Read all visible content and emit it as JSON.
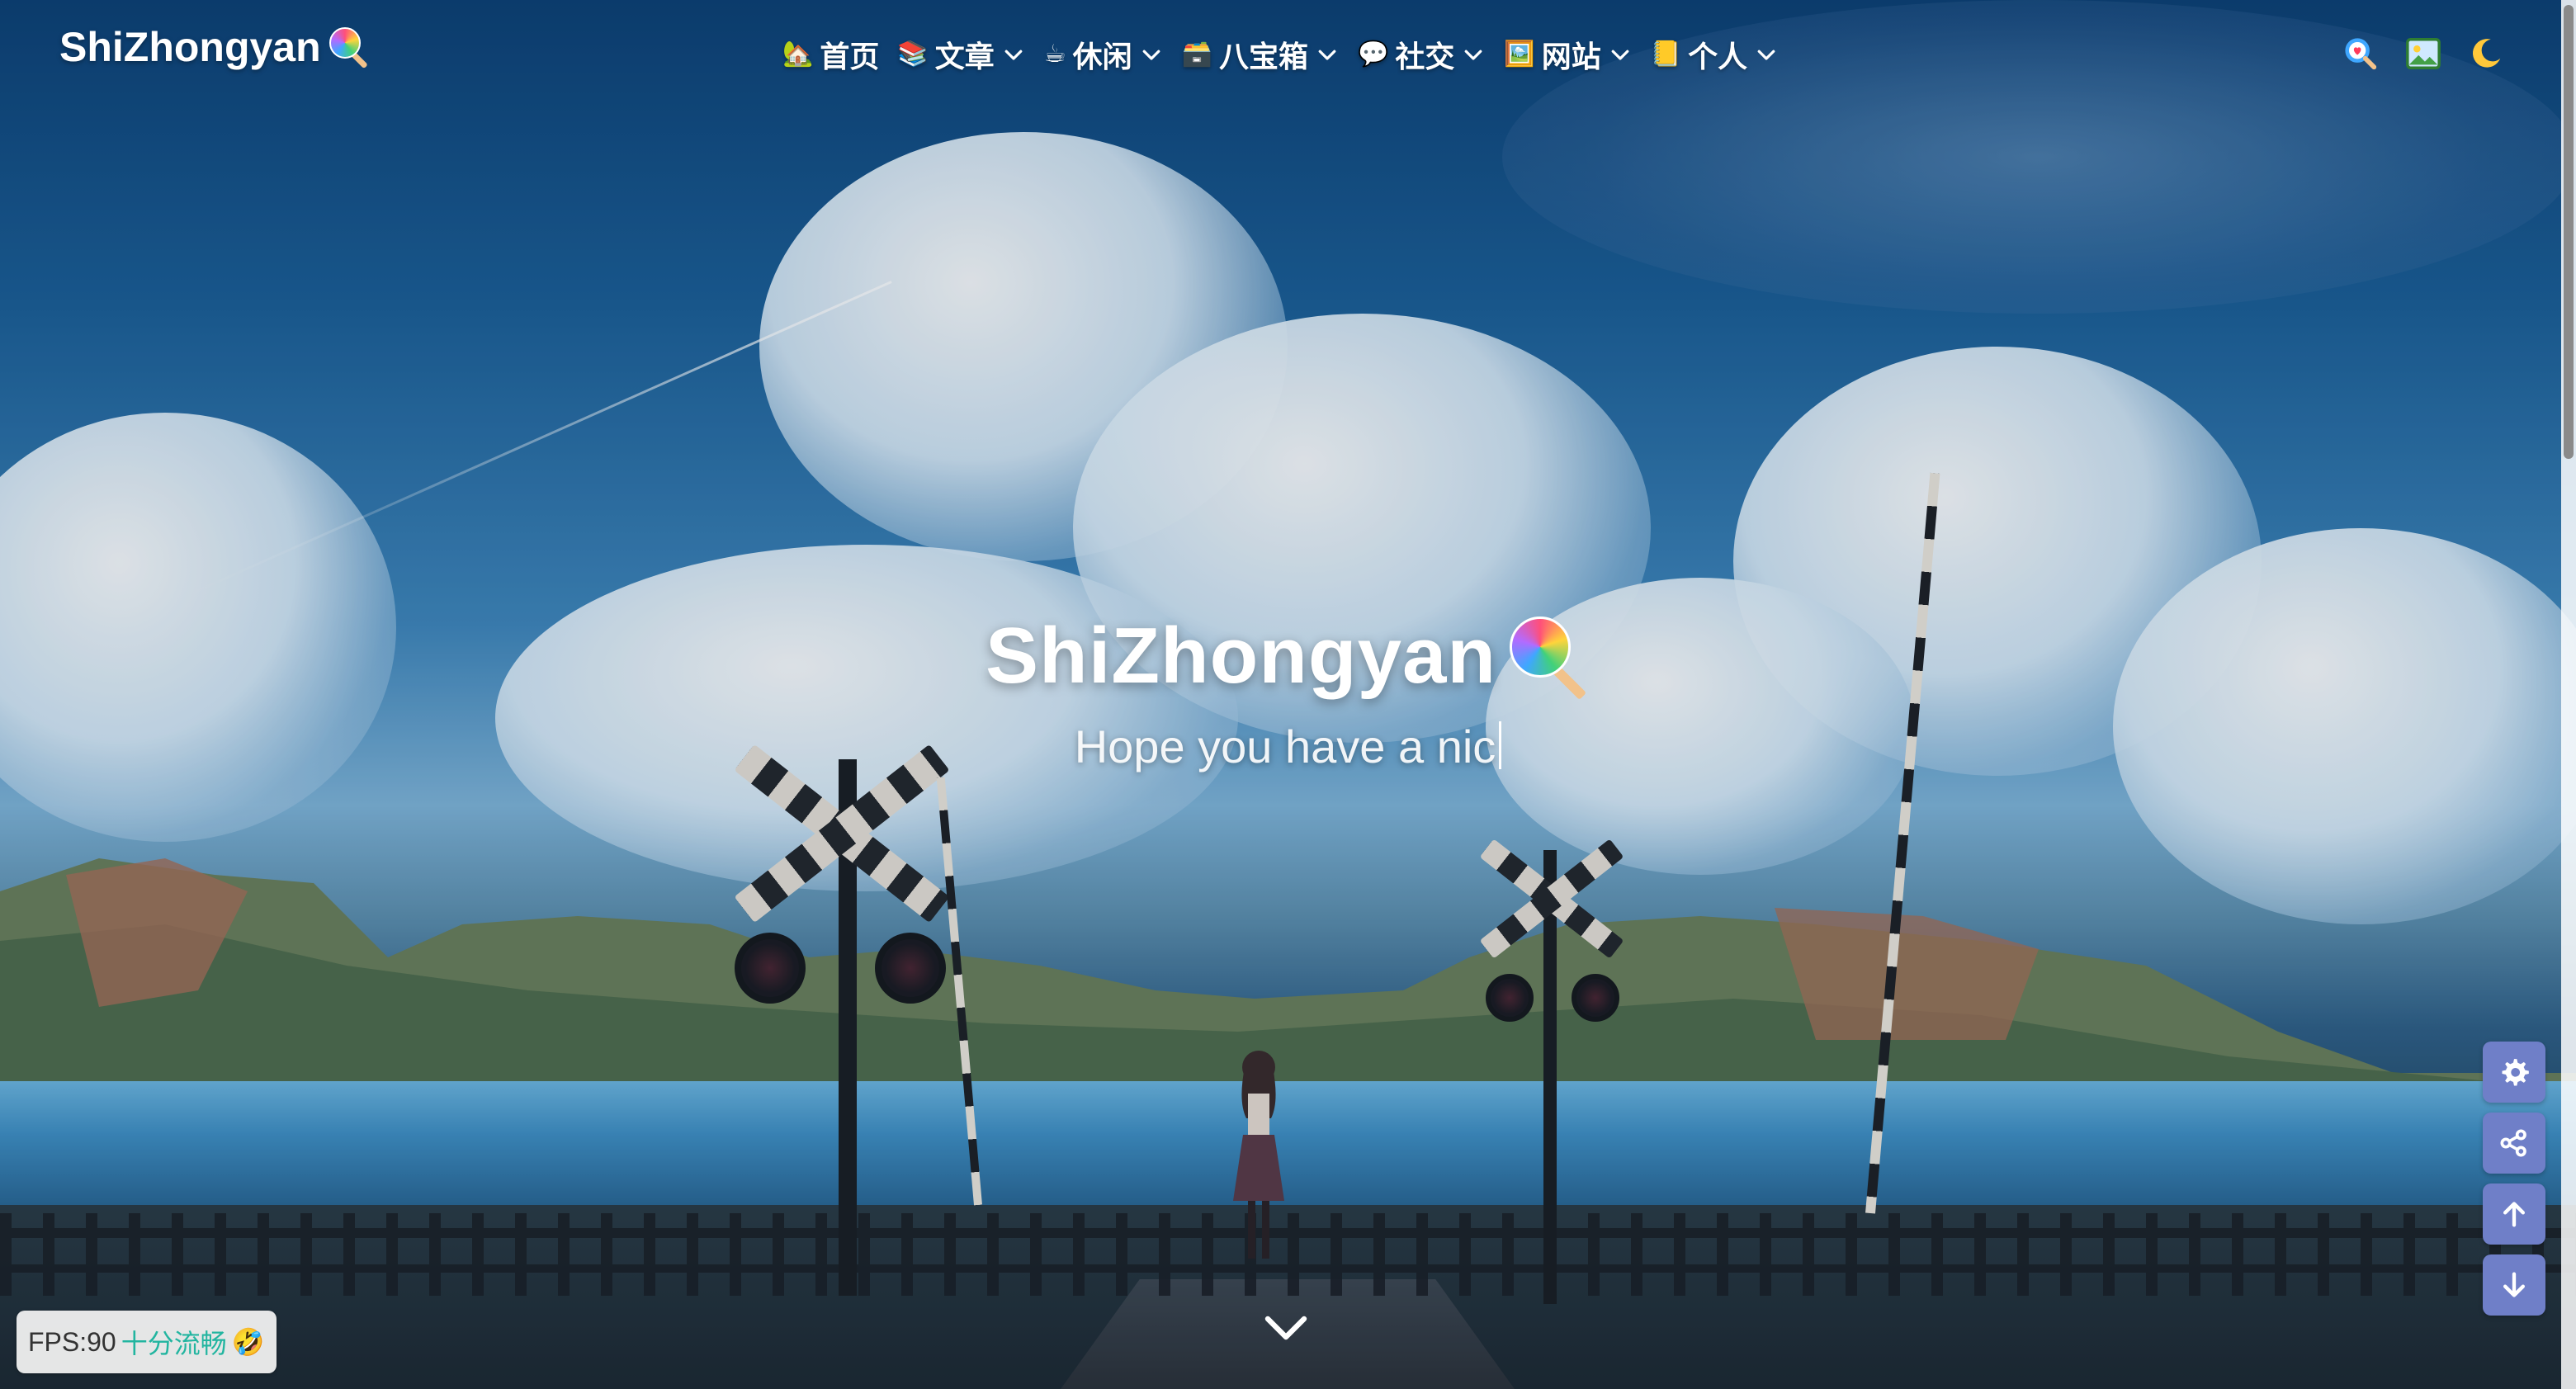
{
  "brand": {
    "name": "ShiZhongyan"
  },
  "nav": {
    "items": [
      {
        "emoji": "🏡",
        "label": "首页",
        "has_dropdown": false
      },
      {
        "emoji": "📚",
        "label": "文章",
        "has_dropdown": true
      },
      {
        "emoji": "☕",
        "label": "休闲",
        "has_dropdown": true
      },
      {
        "emoji": "🗃️",
        "label": "八宝箱",
        "has_dropdown": true
      },
      {
        "emoji": "💬",
        "label": "社交",
        "has_dropdown": true
      },
      {
        "emoji": "🖼️",
        "label": "网站",
        "has_dropdown": true
      },
      {
        "emoji": "📒",
        "label": "个人",
        "has_dropdown": true
      }
    ]
  },
  "right_icons": {
    "search": "search-icon",
    "wallpaper": "wallpaper-icon",
    "theme": "moon-icon"
  },
  "hero": {
    "title": "ShiZhongyan",
    "subtitle": "Hope you have a nic"
  },
  "side_tools": [
    "gear-icon",
    "share-icon",
    "arrow-up-icon",
    "arrow-down-icon"
  ],
  "fps": {
    "label": "FPS:90",
    "status": "十分流畅",
    "emoji": "🤣"
  },
  "colors": {
    "tool_button": "#6f7fc8",
    "fps_status": "#22b5a0",
    "sky_top": "#0c3f73"
  }
}
